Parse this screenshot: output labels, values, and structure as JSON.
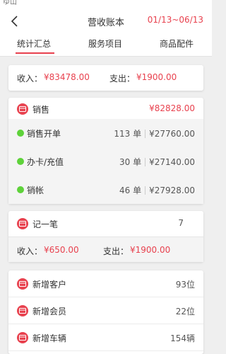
{
  "status": {
    "clipped": "ゆ山"
  },
  "header": {
    "title": "营收账本",
    "date_range": "01/13~06/13"
  },
  "tabs": [
    {
      "label": "统计汇总",
      "active": true
    },
    {
      "label": "服务项目",
      "active": false
    },
    {
      "label": "商品配件",
      "active": false
    }
  ],
  "summary": {
    "income_label": "收入：",
    "income_value": "¥83478.00",
    "expense_label": "支出：",
    "expense_value": "¥1900.00"
  },
  "sales": {
    "header": {
      "label": "销售",
      "value": "¥82828.00",
      "icon": "wallet-icon"
    },
    "items": [
      {
        "label": "销售开单",
        "count": "113 单",
        "amount": "¥27760.00"
      },
      {
        "label": "办卡/充值",
        "count": "30 单",
        "amount": "¥27140.00"
      },
      {
        "label": "销帐",
        "count": "46 单",
        "amount": "¥27928.00"
      }
    ]
  },
  "note": {
    "label": "记一笔",
    "count": "7",
    "icon": "wallet-icon",
    "income_label": "收入：",
    "income_value": "¥650.00",
    "expense_label": "支出：",
    "expense_value": "¥1900.00"
  },
  "stats": [
    {
      "label": "新增客户",
      "value": "93位",
      "icon": "wallet-icon"
    },
    {
      "label": "新增会员",
      "value": "22位",
      "icon": "wallet-icon"
    },
    {
      "label": "新增车辆",
      "value": "154辆",
      "icon": "wallet-icon"
    }
  ],
  "colors": {
    "accent": "#e8414e",
    "green_dot": "#5ed23a",
    "background": "#efefef"
  }
}
